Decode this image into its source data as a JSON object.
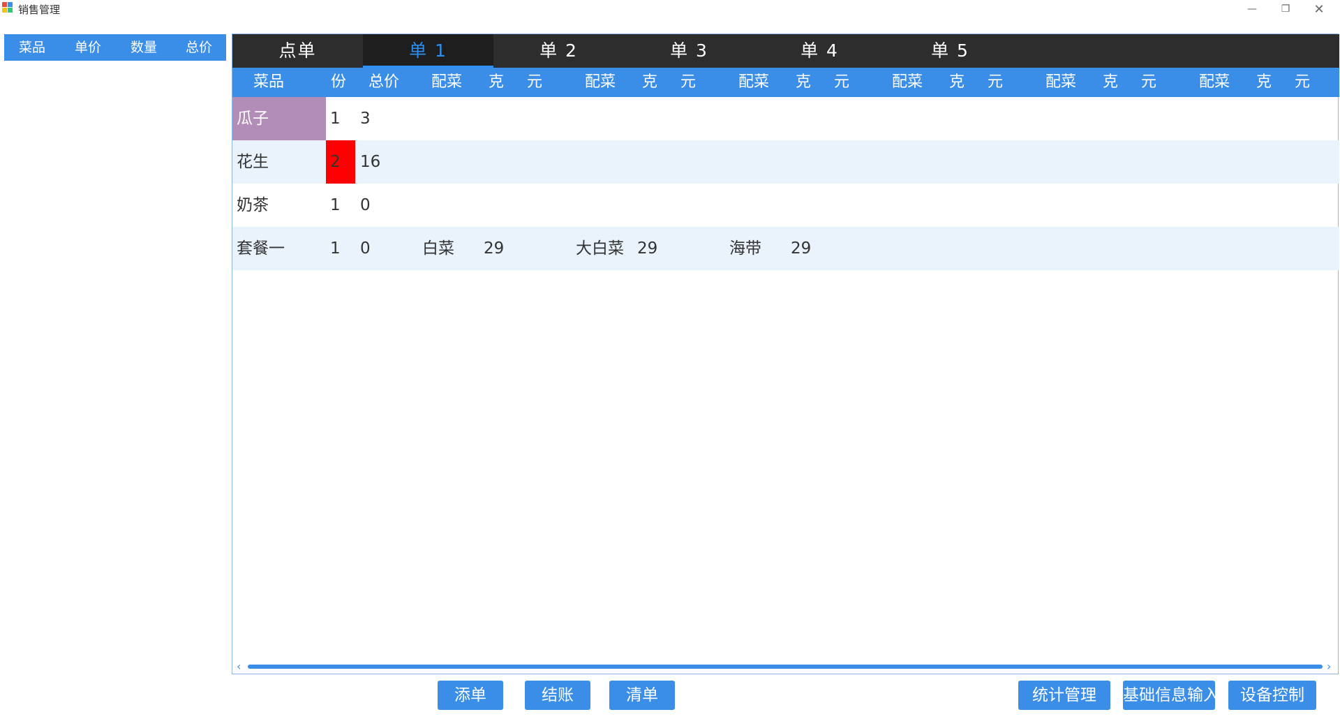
{
  "window": {
    "title": "销售管理",
    "min_icon": "minimize-icon",
    "restore_icon": "restore-icon",
    "close_icon": "close-icon"
  },
  "left_table": {
    "headers": [
      "菜品",
      "单价",
      "数量",
      "总价"
    ]
  },
  "tabs": [
    {
      "label": "点单",
      "active": false
    },
    {
      "label": "单 1",
      "active": true
    },
    {
      "label": "单 2",
      "active": false
    },
    {
      "label": "单 3",
      "active": false
    },
    {
      "label": "单 4",
      "active": false
    },
    {
      "label": "单 5",
      "active": false
    }
  ],
  "columns": [
    "菜品",
    "份",
    "总价",
    "配菜",
    "克",
    "元",
    "配菜",
    "克",
    "元",
    "配菜",
    "克",
    "元",
    "配菜",
    "克",
    "元",
    "配菜",
    "克",
    "元",
    "配菜",
    "克",
    "元"
  ],
  "rows": [
    {
      "name": "瓜子",
      "qty": "1",
      "total": "3",
      "sides": [],
      "name_bg": "#b28db7",
      "qty_bg": ""
    },
    {
      "name": "花生",
      "qty": "2",
      "total": "16",
      "sides": [],
      "name_bg": "",
      "qty_bg": "#ff0000"
    },
    {
      "name": "奶茶",
      "qty": "1",
      "total": "0",
      "sides": [],
      "name_bg": "",
      "qty_bg": ""
    },
    {
      "name": "套餐一",
      "qty": "1",
      "total": "0",
      "sides": [
        {
          "name": "白菜",
          "grams": "29"
        },
        {
          "name": "大白菜",
          "grams": "29"
        },
        {
          "name": "海带",
          "grams": "29"
        }
      ],
      "name_bg": "",
      "qty_bg": ""
    }
  ],
  "buttons": {
    "add_order": "添单",
    "checkout": "结账",
    "clear": "清单",
    "stats": "统计管理",
    "basic_info": "基础信息输入",
    "device": "设备控制"
  },
  "colors": {
    "accent": "#3a8ee8",
    "tabbar": "#2d2d2d",
    "active_tab_text": "#2f8ff0",
    "row_alt": "#eaf2fc"
  }
}
